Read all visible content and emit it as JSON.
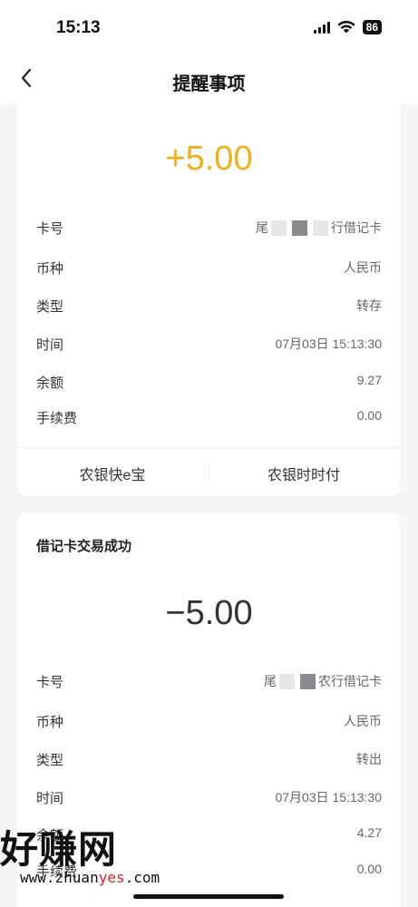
{
  "status_bar": {
    "time": "15:13",
    "battery": "86"
  },
  "nav": {
    "title": "提醒事项"
  },
  "card1": {
    "amount": "+5.00",
    "rows": [
      {
        "label": "卡号",
        "value_prefix": "尾",
        "value_suffix": "行借记卡"
      },
      {
        "label": "币种",
        "value": "人民币"
      },
      {
        "label": "类型",
        "value": "转存"
      },
      {
        "label": "时间",
        "value": "07月03日 15:13:30"
      },
      {
        "label": "余额",
        "value": "9.27"
      },
      {
        "label": "手续费",
        "value": "0.00"
      }
    ],
    "footer_left": "农银快e宝",
    "footer_right": "农银时时付"
  },
  "card2": {
    "title": "借记卡交易成功",
    "amount": "−5.00",
    "rows": [
      {
        "label": "卡号",
        "value_prefix": "尾",
        "value_suffix": "农行借记卡"
      },
      {
        "label": "币种",
        "value": "人民币"
      },
      {
        "label": "类型",
        "value": "转出"
      },
      {
        "label": "时间",
        "value": "07月03日 15:13:30"
      },
      {
        "label": "余额",
        "value": "4.27"
      },
      {
        "label": "手续费",
        "value": "0.00"
      }
    ]
  },
  "watermark": {
    "logo_text": "好赚网",
    "url_prefix": "www.zhuan",
    "url_red": "yes",
    "url_suffix": ".com"
  },
  "colors": {
    "positive_amount": "#f0b01a",
    "negative_amount": "#333333",
    "background": "#f4f5f7"
  }
}
